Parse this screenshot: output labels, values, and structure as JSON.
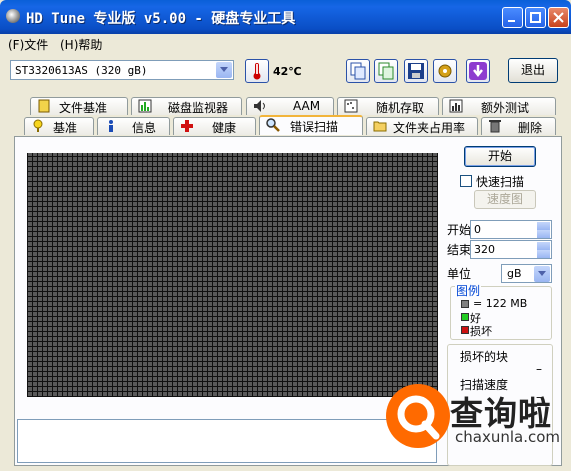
{
  "window": {
    "title": "HD Tune 专业版 v5.00 - 硬盘专业工具"
  },
  "menu": [
    {
      "label": "(F)文件"
    },
    {
      "label": "(H)帮助"
    }
  ],
  "toolbar": {
    "drive_value": "ST3320613AS (320 gB)",
    "temperature": "42℃",
    "exit_label": "退出"
  },
  "tabs_top": [
    {
      "label": "文件基准",
      "icon": "file-benchmark-icon"
    },
    {
      "label": "磁盘监视器",
      "icon": "disk-monitor-icon"
    },
    {
      "label": "AAM",
      "icon": "speaker-icon"
    },
    {
      "label": "随机存取",
      "icon": "random-access-icon"
    },
    {
      "label": "额外测试",
      "icon": "extra-tests-icon"
    }
  ],
  "tabs_bottom": [
    {
      "label": "基准",
      "icon": "benchmark-icon"
    },
    {
      "label": "信息",
      "icon": "info-icon"
    },
    {
      "label": "健康",
      "icon": "health-cross-icon"
    },
    {
      "label": "错误扫描",
      "icon": "magnifier-icon",
      "active": true
    },
    {
      "label": "文件夹占用率",
      "icon": "folder-icon"
    },
    {
      "label": "删除",
      "icon": "trash-icon"
    }
  ],
  "scan": {
    "start_button": "开始",
    "quick_scan_label": "快速扫描",
    "quick_scan_checked": false,
    "speed_button": "速度图",
    "start_label": "开始",
    "start_value": "0",
    "end_label": "结束",
    "end_value": "320",
    "unit_label": "单位",
    "unit_value": "gB"
  },
  "legend": {
    "title": "图例",
    "items": [
      {
        "label": "= 122 MB",
        "color": "#808080"
      },
      {
        "label": "好",
        "color": "#22cc22"
      },
      {
        "label": "损坏",
        "color": "#cc1111"
      }
    ]
  },
  "stats": {
    "damaged_label": "损坏的块",
    "damaged_value": "–",
    "speed_label": "扫描速度",
    "speed_value": "–"
  },
  "watermark": {
    "text": "查询啦",
    "sub": "chaxunla.com"
  }
}
